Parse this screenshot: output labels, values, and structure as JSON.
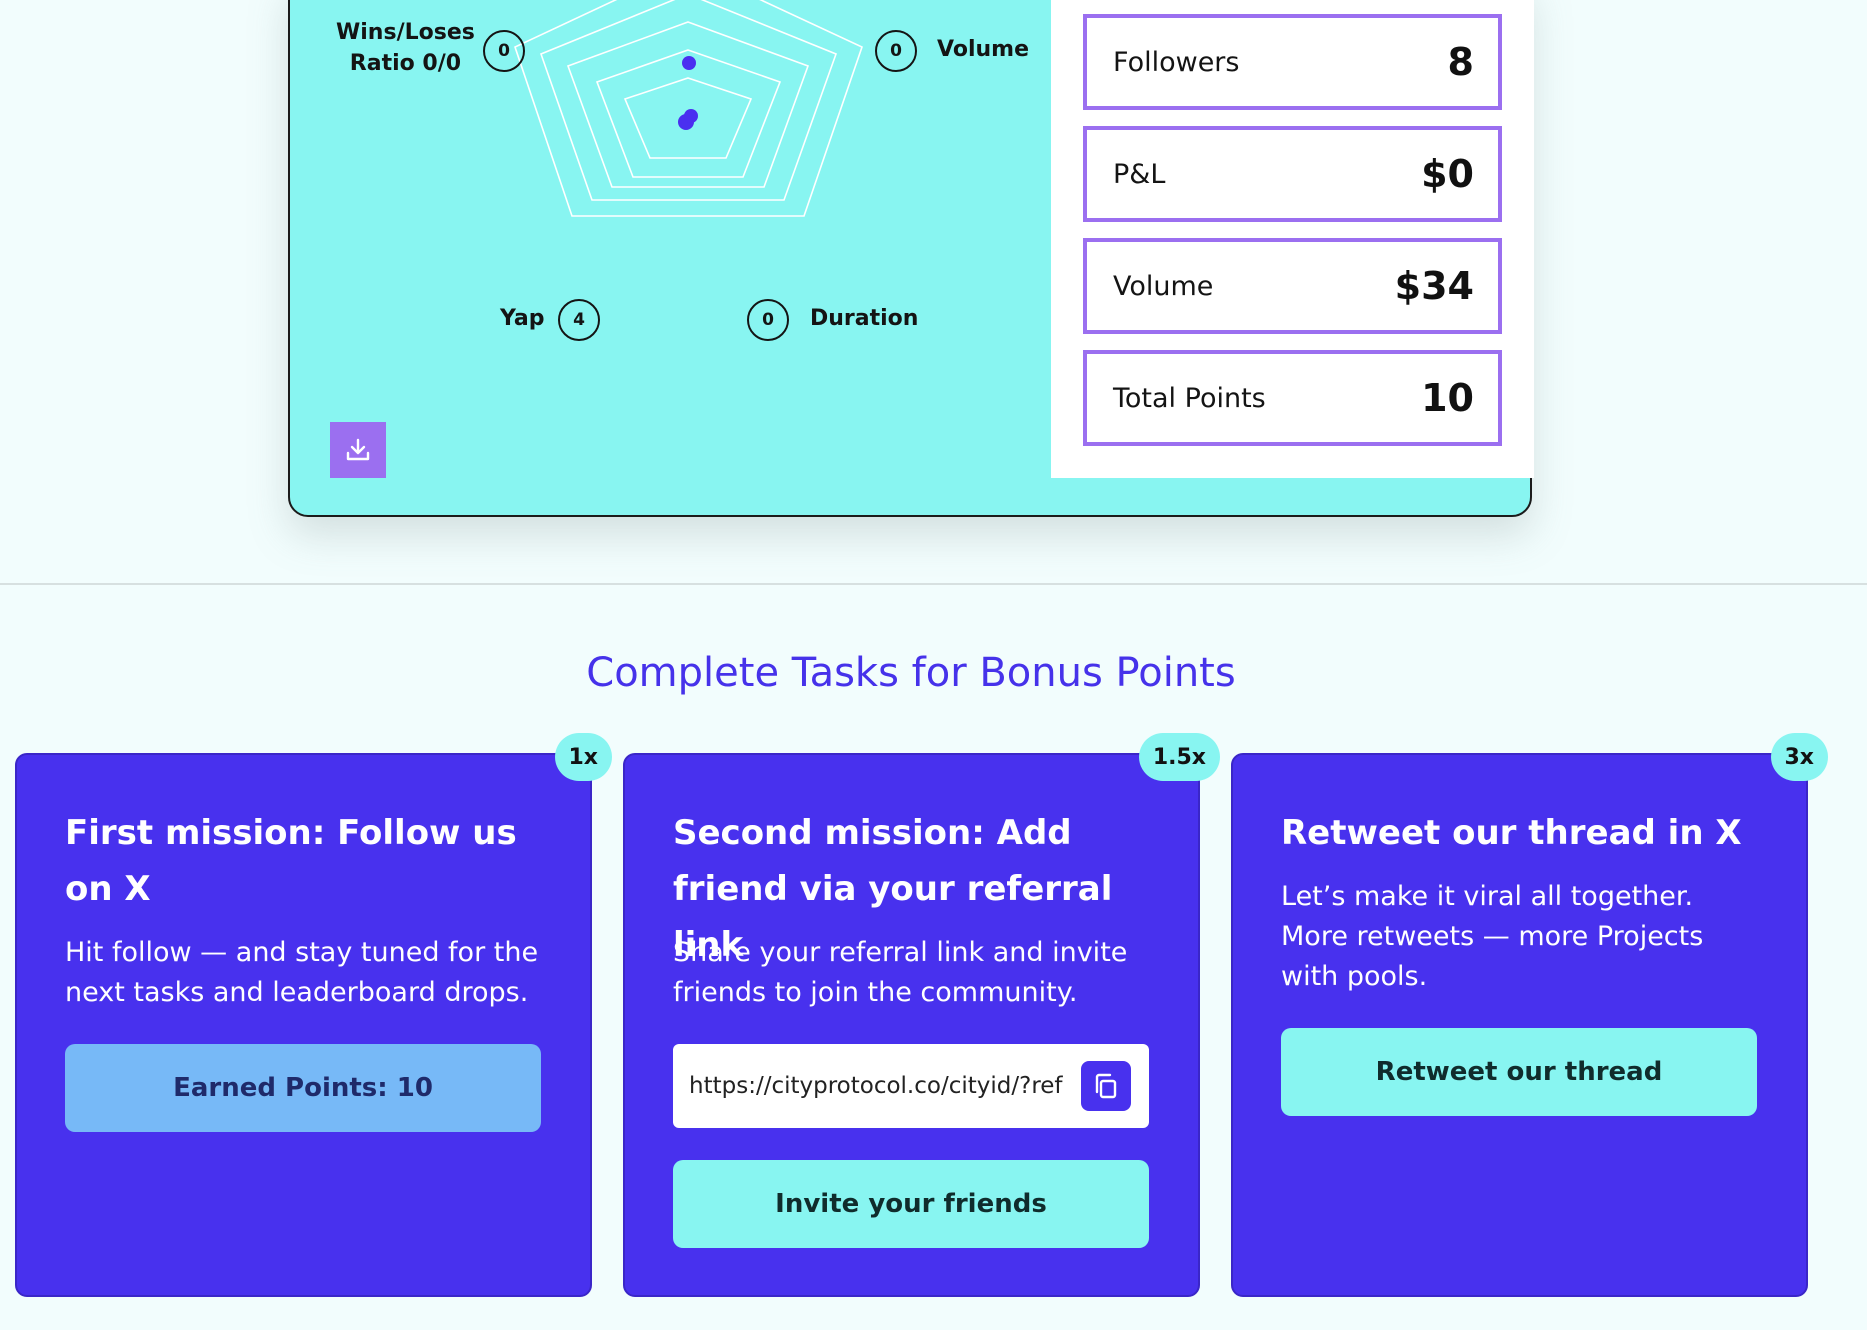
{
  "profile": {
    "radar_labels": {
      "wins_loses_line1": "Wins/Loses",
      "wins_loses_line2": "Ratio 0/0",
      "wins_loses_value": "0",
      "volume": "Volume",
      "volume_value": "0",
      "yap": "Yap",
      "yap_value": "4",
      "duration": "Duration",
      "duration_value": "0"
    },
    "download_icon": "download-icon",
    "metrics": [
      {
        "label": "Followers",
        "value": "8"
      },
      {
        "label": "P&L",
        "value": "$0"
      },
      {
        "label": "Volume",
        "value": "$34"
      },
      {
        "label": "Total Points",
        "value": "10"
      }
    ]
  },
  "tasks": {
    "title": "Complete Tasks for Bonus Points",
    "missions": [
      {
        "multiplier": "1x",
        "title": "First mission: Follow us on X",
        "description": "Hit follow — and stay tuned for the next tasks and leaderboard drops.",
        "button": "Earned Points: 10"
      },
      {
        "multiplier": "1.5x",
        "title": "Second mission: Add friend via your referral link",
        "description": "Share your referral link and invite friends to join the community.",
        "referral_link": "https://cityprotocol.co/cityid/?ref",
        "copy_icon": "copy-icon",
        "button": "Invite your friends"
      },
      {
        "multiplier": "3x",
        "title": "Retweet our thread in X",
        "description": "Let’s make it viral all together. More retweets — more Projects with pools.",
        "button": "Retweet our thread"
      }
    ]
  },
  "colors": {
    "card_bg": "#88f5f1",
    "accent_purple": "#4831ee",
    "metric_border": "#9b6ff0",
    "earned_button": "#77b9f7",
    "title_color": "#4632ea"
  }
}
